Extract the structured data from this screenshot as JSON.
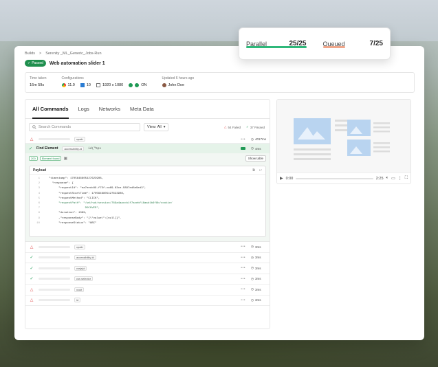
{
  "float_card": {
    "parallel_label": "Parallel",
    "parallel_value": "25/25",
    "parallel_progress": 1.0,
    "queued_label": "Queued",
    "queued_value": "7/25"
  },
  "breadcrumb": {
    "root": "Builds",
    "separator": ">",
    "current": "Serenity _ML_Generic_Jobs-Run"
  },
  "build": {
    "status": "Passed",
    "title": "Web automation slider 1"
  },
  "info": {
    "time_label": "Time taken",
    "time_value": "16m 59s",
    "config_label": "Configurations",
    "browser_version": "11.0",
    "os_version": "10",
    "resolution": "1920 x 1080",
    "toggle_value": "ON",
    "updated_label": "Updated 6 hours ago",
    "user": "John Doe"
  },
  "tabs": [
    "All Commands",
    "Logs",
    "Networks",
    "Meta Data"
  ],
  "search": {
    "placeholder": "Search Commands"
  },
  "view_select": "View: All",
  "counts": {
    "failed": "54 Failed",
    "passed": "37 Passed"
  },
  "rows_top": [
    {
      "status": "fail",
      "tag": "xpath",
      "time": "4017ms"
    }
  ],
  "expanded": {
    "name": "Find Element",
    "tag": "accessibility-id",
    "selector": "id(\"5px",
    "time": "4ms",
    "meta_tag1": "200",
    "meta_tag2": "Element found",
    "show_table": "Show table",
    "payload_title": "Payload",
    "code_lines": [
      {
        "n": "1",
        "t": "  \"timestamp\": 1705646805427623908,",
        "s": false
      },
      {
        "n": "2",
        "t": "    \"response\": {",
        "s": false
      },
      {
        "n": "3",
        "t": "        \"requestId\": \"ea7eedc89-f75f-ca69-83ce-5897ed8e9ed3\",",
        "s": false
      },
      {
        "n": "4",
        "t": "        \"requestStartTime\": 1705646805427623908,",
        "s": false
      },
      {
        "n": "5",
        "t": "        \"requestMethod\": \"CLICK\",",
        "s": false
      },
      {
        "n": "6",
        "t": "        \"requestPath\": \"/wd/hub/session/789a4aaccb1f7acebf18aad1b6f8b/cookie/",
        "s": true
      },
      {
        "n": "7",
        "t": "                        DOC0VER\",",
        "s": true
      },
      {
        "n": "8",
        "t": "        \"duration\": 1389,",
        "s": false
      },
      {
        "n": "9",
        "t": "        ,\"responseBody\": \"{\\\"value\\\":[null]}\",",
        "s": false
      },
      {
        "n": "10",
        "t": "        \"responseStatus\": \"ABC\"",
        "s": false
      }
    ]
  },
  "rows_bottom": [
    {
      "status": "fail",
      "tag": "xpath",
      "time": "3ms"
    },
    {
      "status": "pass",
      "tag": "accessibility-id",
      "time": "3ms"
    },
    {
      "status": "pass",
      "tag": "cssjs(d",
      "time": "3ms"
    },
    {
      "status": "pass",
      "tag": "css selector",
      "time": "3ms"
    },
    {
      "status": "fail",
      "tag": "xcuit",
      "time": "3ms"
    },
    {
      "status": "fail",
      "tag": "id",
      "time": "3ms"
    }
  ],
  "video": {
    "current_time": "0:00",
    "duration": "2:25"
  },
  "colors": {
    "pass": "#1f9a55",
    "fail": "#e04e4e",
    "accent_green": "#2fb87a",
    "accent_orange": "#f0a68a",
    "image_blue": "#b9d4f0"
  }
}
